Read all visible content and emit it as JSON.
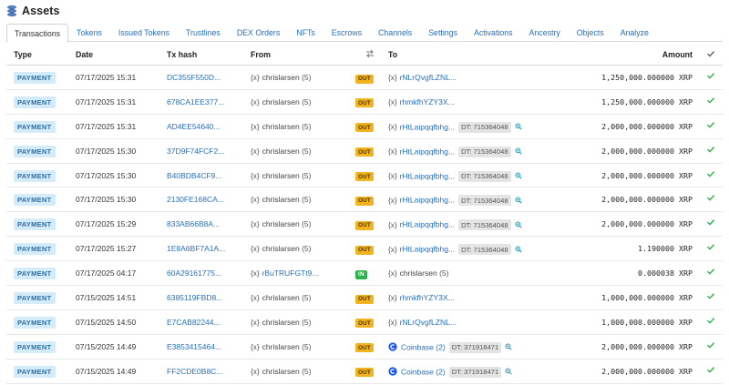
{
  "header": {
    "title": "Assets",
    "icon": "coins-stack-icon"
  },
  "tabs": [
    {
      "label": "Transactions",
      "active": true
    },
    {
      "label": "Tokens"
    },
    {
      "label": "Issued Tokens"
    },
    {
      "label": "Trustlines"
    },
    {
      "label": "DEX Orders"
    },
    {
      "label": "NFTs"
    },
    {
      "label": "Escrows"
    },
    {
      "label": "Channels"
    },
    {
      "label": "Settings"
    },
    {
      "label": "Activations"
    },
    {
      "label": "Ancestry"
    },
    {
      "label": "Objects"
    },
    {
      "label": "Analyze"
    }
  ],
  "columns": {
    "type": "Type",
    "date": "Date",
    "hash": "Tx hash",
    "from": "From",
    "direction_icon": "swap-arrows-icon",
    "to": "To",
    "amount": "Amount",
    "status_icon": "check-icon"
  },
  "colors": {
    "accent": "#2a6fb7",
    "out": "#f2b320",
    "in": "#2eb24b",
    "success": "#2eb24b"
  },
  "rows": [
    {
      "type": "PAYMENT",
      "date": "07/17/2025 15:31",
      "hash": "DC355F550D...",
      "from": {
        "curly": "{x}",
        "name": "chrislarsen",
        "count": "(5)"
      },
      "dir": "OUT",
      "to": {
        "kind": "curly",
        "curly": "{x}",
        "name": "rNLrQvgfLZNL..."
      },
      "amount": "1,250,000.000000 XRP"
    },
    {
      "type": "PAYMENT",
      "date": "07/17/2025 15:31",
      "hash": "678CA1EE377...",
      "from": {
        "curly": "{x}",
        "name": "chrislarsen",
        "count": "(5)"
      },
      "dir": "OUT",
      "to": {
        "kind": "curly",
        "curly": "{x}",
        "name": "rhmkfhYZY3X..."
      },
      "amount": "1,250,000.000000 XRP"
    },
    {
      "type": "PAYMENT",
      "date": "07/17/2025 15:31",
      "hash": "AD4EE54640...",
      "from": {
        "curly": "{x}",
        "name": "chrislarsen",
        "count": "(5)"
      },
      "dir": "OUT",
      "to": {
        "kind": "curly",
        "curly": "{x}",
        "name": "rHtLaipqqfbhg...",
        "dt": "DT: 715364048"
      },
      "amount": "2,000,000.000000 XRP"
    },
    {
      "type": "PAYMENT",
      "date": "07/17/2025 15:30",
      "hash": "37D9F74FCF2...",
      "from": {
        "curly": "{x}",
        "name": "chrislarsen",
        "count": "(5)"
      },
      "dir": "OUT",
      "to": {
        "kind": "curly",
        "curly": "{x}",
        "name": "rHtLaipqqfbhg...",
        "dt": "DT: 715364048"
      },
      "amount": "2,000,000.000000 XRP"
    },
    {
      "type": "PAYMENT",
      "date": "07/17/2025 15:30",
      "hash": "B40BDB4CF9...",
      "from": {
        "curly": "{x}",
        "name": "chrislarsen",
        "count": "(5)"
      },
      "dir": "OUT",
      "to": {
        "kind": "curly",
        "curly": "{x}",
        "name": "rHtLaipqqfbhg...",
        "dt": "DT: 715364048"
      },
      "amount": "2,000,000.000000 XRP"
    },
    {
      "type": "PAYMENT",
      "date": "07/17/2025 15:30",
      "hash": "2130FE168CA...",
      "from": {
        "curly": "{x}",
        "name": "chrislarsen",
        "count": "(5)"
      },
      "dir": "OUT",
      "to": {
        "kind": "curly",
        "curly": "{x}",
        "name": "rHtLaipqqfbhg...",
        "dt": "DT: 715364048"
      },
      "amount": "2,000,000.000000 XRP"
    },
    {
      "type": "PAYMENT",
      "date": "07/17/2025 15:29",
      "hash": "833AB66B8A...",
      "from": {
        "curly": "{x}",
        "name": "chrislarsen",
        "count": "(5)"
      },
      "dir": "OUT",
      "to": {
        "kind": "curly",
        "curly": "{x}",
        "name": "rHtLaipqqfbhg...",
        "dt": "DT: 715364048"
      },
      "amount": "2,000,000.000000 XRP"
    },
    {
      "type": "PAYMENT",
      "date": "07/17/2025 15:27",
      "hash": "1E8A6BF7A1A...",
      "from": {
        "curly": "{x}",
        "name": "chrislarsen",
        "count": "(5)"
      },
      "dir": "OUT",
      "to": {
        "kind": "curly",
        "curly": "{x}",
        "name": "rHtLaipqqfbhg...",
        "dt": "DT: 715364048"
      },
      "amount": "1.190000 XRP"
    },
    {
      "type": "PAYMENT",
      "date": "07/17/2025 04:17",
      "hash": "60A29161775...",
      "from": {
        "curly": "{x}",
        "name": "rBuTRUFGTt9...",
        "count": ""
      },
      "dir": "IN",
      "to": {
        "kind": "self",
        "curly": "{x}",
        "name": "chrislarsen",
        "count": "(5)"
      },
      "amount": "0.000038 XRP"
    },
    {
      "type": "PAYMENT",
      "date": "07/15/2025 14:51",
      "hash": "6385119FBD8...",
      "from": {
        "curly": "{x}",
        "name": "chrislarsen",
        "count": "(5)"
      },
      "dir": "OUT",
      "to": {
        "kind": "curly",
        "curly": "{x}",
        "name": "rhmkfhYZY3X..."
      },
      "amount": "1,000,000.000000 XRP"
    },
    {
      "type": "PAYMENT",
      "date": "07/15/2025 14:50",
      "hash": "E7CAB82244...",
      "from": {
        "curly": "{x}",
        "name": "chrislarsen",
        "count": "(5)"
      },
      "dir": "OUT",
      "to": {
        "kind": "curly",
        "curly": "{x}",
        "name": "rNLrQvgfLZNL..."
      },
      "amount": "1,000,000.000000 XRP"
    },
    {
      "type": "PAYMENT",
      "date": "07/15/2025 14:49",
      "hash": "E3853415464...",
      "from": {
        "curly": "{x}",
        "name": "chrislarsen",
        "count": "(5)"
      },
      "dir": "OUT",
      "to": {
        "kind": "service",
        "name": "Coinbase",
        "count": "(2)",
        "dt": "DT: 371918471"
      },
      "amount": "2,000,000.000000 XRP"
    },
    {
      "type": "PAYMENT",
      "date": "07/15/2025 14:49",
      "hash": "FF2CDE0B8C...",
      "from": {
        "curly": "{x}",
        "name": "chrislarsen",
        "count": "(5)"
      },
      "dir": "OUT",
      "to": {
        "kind": "service",
        "name": "Coinbase",
        "count": "(2)",
        "dt": "DT: 371918471"
      },
      "amount": "2,000,000.000000 XRP"
    }
  ]
}
